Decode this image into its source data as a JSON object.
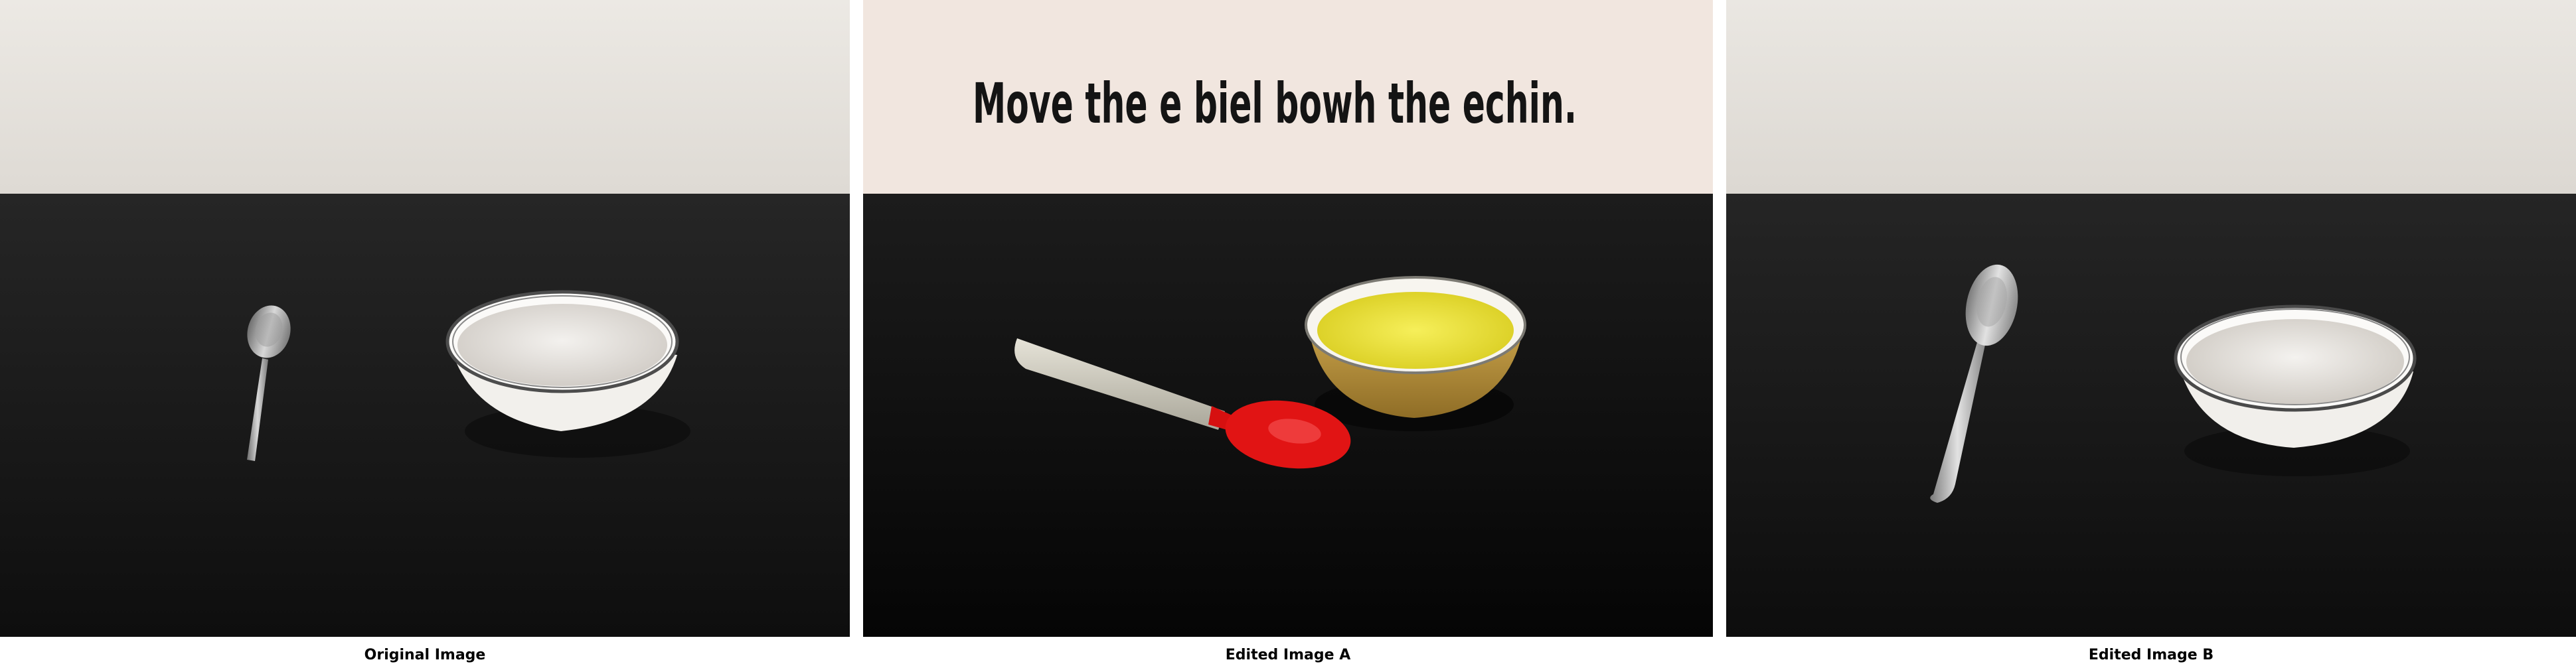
{
  "panels": [
    {
      "caption": "Original Image"
    },
    {
      "caption": "Edited Image A",
      "overlay_text": "Move the e biel bowh the echin."
    },
    {
      "caption": "Edited Image B"
    }
  ],
  "scene": {
    "objects": [
      "spoon",
      "bowl"
    ],
    "wall_color": "#e6e2dc",
    "table_color": "#151515"
  }
}
